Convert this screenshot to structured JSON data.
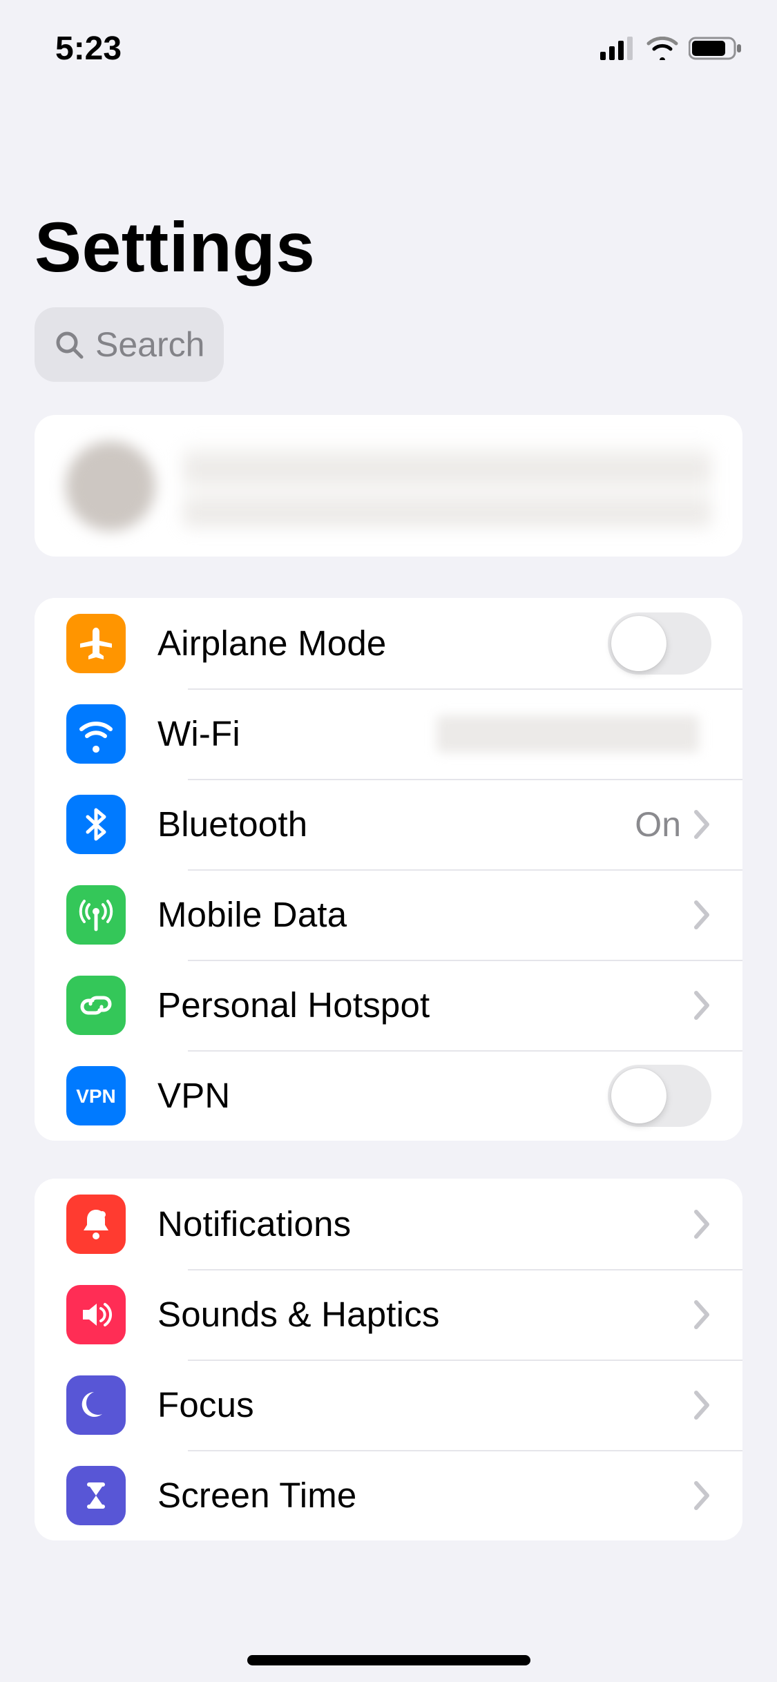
{
  "status_bar": {
    "time": "5:23"
  },
  "page": {
    "title": "Settings"
  },
  "search": {
    "placeholder": "Search"
  },
  "groups": {
    "connectivity": {
      "airplane": {
        "label": "Airplane Mode",
        "toggle": false
      },
      "wifi": {
        "label": "Wi-Fi"
      },
      "bluetooth": {
        "label": "Bluetooth",
        "value": "On"
      },
      "mobile": {
        "label": "Mobile Data"
      },
      "hotspot": {
        "label": "Personal Hotspot"
      },
      "vpn": {
        "label": "VPN",
        "toggle": false
      }
    },
    "alerts": {
      "notifications": {
        "label": "Notifications"
      },
      "sounds": {
        "label": "Sounds & Haptics"
      },
      "focus": {
        "label": "Focus"
      },
      "screentime": {
        "label": "Screen Time"
      }
    }
  },
  "icons": {
    "airplane": "airplane-icon",
    "wifi": "wifi-icon",
    "bluetooth": "bluetooth-icon",
    "mobile": "antenna-icon",
    "hotspot": "link-icon",
    "vpn": "vpn-icon",
    "notifications": "bell-icon",
    "sounds": "speaker-icon",
    "focus": "moon-icon",
    "screentime": "hourglass-icon"
  },
  "colors": {
    "orange": "#ff9500",
    "blue": "#007aff",
    "green": "#34c759",
    "red": "#ff3b30",
    "redpink": "#ff2d55",
    "indigo": "#5856d6",
    "bg": "#f2f2f7",
    "separator": "#e5e5ea",
    "secondary_text": "#8a8a8e"
  }
}
